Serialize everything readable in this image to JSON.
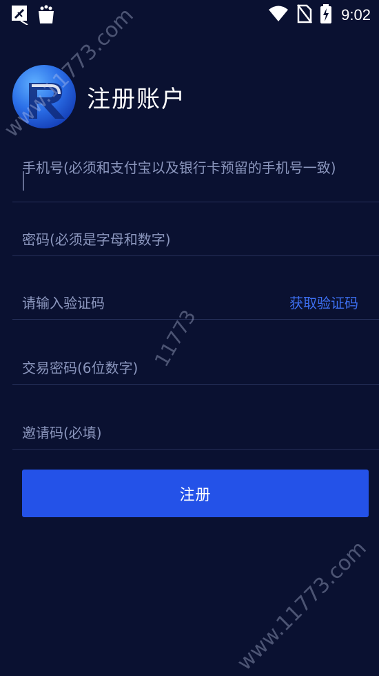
{
  "status_bar": {
    "time": "9:02"
  },
  "header": {
    "title": "注册账户"
  },
  "form": {
    "phone_placeholder": "手机号(必须和支付宝以及银行卡预留的手机号一致)",
    "password_placeholder": "密码(必须是字母和数字)",
    "code_placeholder": "请输入验证码",
    "get_code_label": "获取验证码",
    "trade_password_placeholder": "交易密码(6位数字)",
    "invite_placeholder": "邀请码(必填)",
    "submit_label": "注册"
  },
  "watermarks": {
    "top": "www.11773.com",
    "middle": "11773",
    "bottom": "www.11773.com"
  },
  "colors": {
    "background": "#0a1131",
    "accent": "#2452e8",
    "link": "#3d6ff0",
    "placeholder": "#8b96bd"
  },
  "icons": [
    "no-signal-notification-icon",
    "bag-notification-icon",
    "wifi-icon",
    "no-sim-icon",
    "battery-charging-icon",
    "app-logo"
  ]
}
